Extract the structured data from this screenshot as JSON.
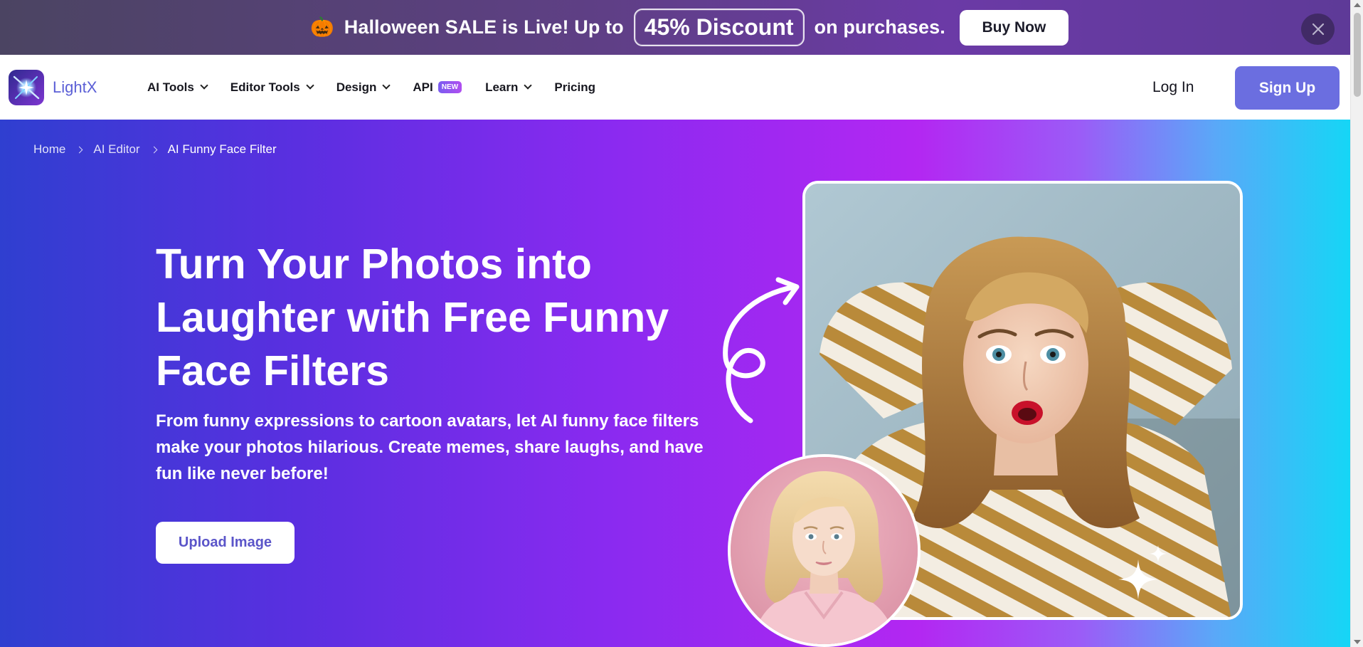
{
  "promo": {
    "emoji": "🎃",
    "text_before": "Halloween SALE is Live! Up to",
    "discount": "45% Discount",
    "text_after": "on purchases.",
    "button": "Buy Now",
    "close_icon": "close-icon"
  },
  "nav": {
    "brand": "LightX",
    "items": [
      {
        "label": "AI Tools",
        "dropdown": true
      },
      {
        "label": "Editor Tools",
        "dropdown": true
      },
      {
        "label": "Design",
        "dropdown": true
      },
      {
        "label": "API",
        "badge": "NEW"
      },
      {
        "label": "Learn",
        "dropdown": true
      },
      {
        "label": "Pricing"
      }
    ],
    "login": "Log In",
    "signup": "Sign Up"
  },
  "breadcrumb": [
    "Home",
    "AI Editor",
    "AI Funny Face Filter"
  ],
  "hero": {
    "title_line1": "Turn Your Photos into",
    "title_line2": "Laughter with Free Funny",
    "title_line3": "Face Filters",
    "subtitle": "From funny expressions to cartoon avatars, let AI funny face filters make your photos hilarious. Create memes, share laughs, and have fun like never before!",
    "cta": "Upload Image"
  },
  "colors": {
    "accent": "#6b6ee0",
    "brand_text": "#5b5fd6",
    "hero_start": "#2f3fd0",
    "hero_mid": "#b327f2",
    "hero_end": "#15d6f6"
  }
}
